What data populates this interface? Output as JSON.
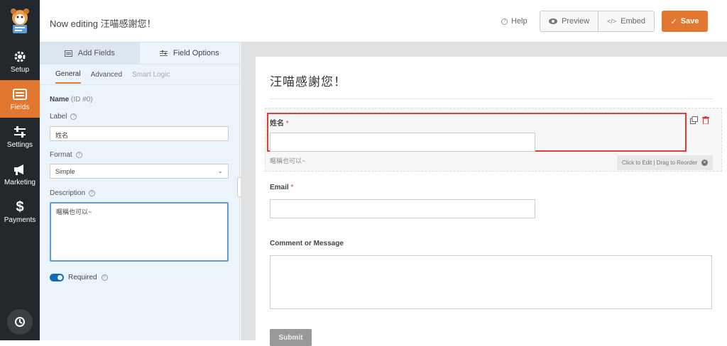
{
  "sidebar": {
    "items": [
      {
        "label": "Setup",
        "icon": "gear-icon"
      },
      {
        "label": "Fields",
        "icon": "fields-icon",
        "active": true
      },
      {
        "label": "Settings",
        "icon": "sliders-icon"
      },
      {
        "label": "Marketing",
        "icon": "megaphone-icon"
      },
      {
        "label": "Payments",
        "icon": "dollar-icon"
      }
    ]
  },
  "header": {
    "editing": "Now editing 汪喵感謝您！",
    "help": "Help",
    "preview": "Preview",
    "embed": "Embed",
    "save": "Save"
  },
  "panel": {
    "tabs": [
      "Add Fields",
      "Field Options"
    ],
    "subtabs": [
      "General",
      "Advanced",
      "Smart Logic"
    ],
    "field_name": "Name",
    "field_id": "(ID #0)",
    "label_label": "Label",
    "label_value": "姓名",
    "format_label": "Format",
    "format_value": "Simple",
    "description_label": "Description",
    "description_value": "暱稱也可以~",
    "required_label": "Required"
  },
  "form": {
    "title": "汪喵感謝您！",
    "name_label": "姓名",
    "name_desc": "暱稱也可以~",
    "reorder_hint": "Click to Edit | Drag to Reorder",
    "email_label": "Email",
    "comment_label": "Comment or Message",
    "submit": "Submit",
    "required_marker": "*"
  },
  "colors": {
    "accent": "#e27730",
    "sidebar": "#23282d",
    "panel": "#ebf3fb",
    "highlight_border": "#e53935",
    "toggle": "#0e6bb7"
  }
}
